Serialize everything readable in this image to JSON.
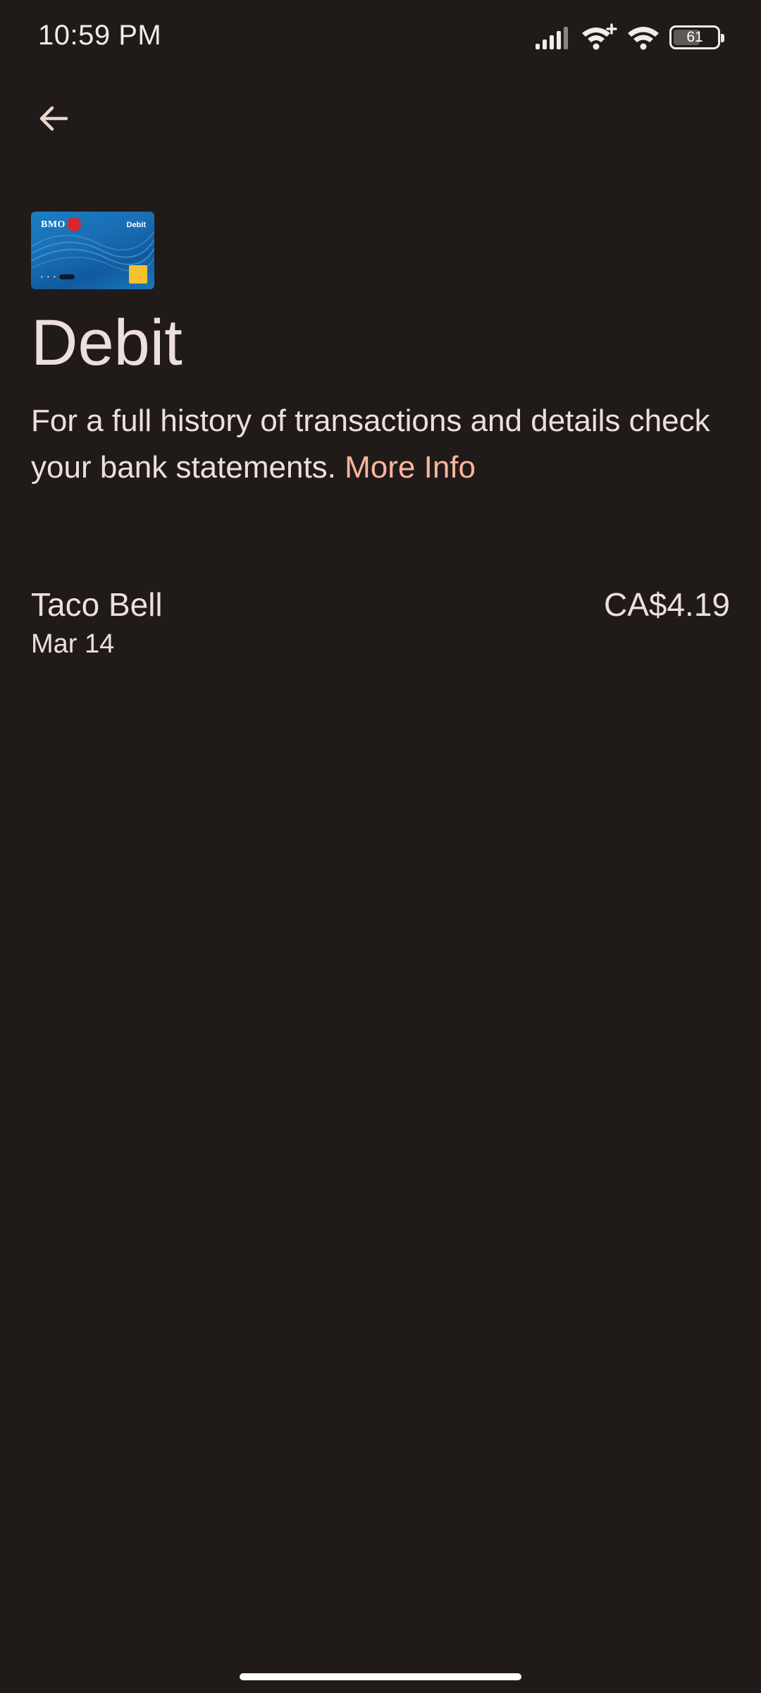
{
  "status_bar": {
    "time": "10:59 PM",
    "battery_level": "61",
    "battery_fraction": 0.61,
    "icons": [
      "signal-icon",
      "wifi-plus-icon",
      "wifi-icon",
      "battery-icon"
    ]
  },
  "header": {
    "back_icon": "arrow-left-icon"
  },
  "card": {
    "bank": "BMO",
    "type": "Debit",
    "dots": "• • • •"
  },
  "page": {
    "title": "Debit",
    "description": "For a full history of transactions and details check your bank statements.",
    "more_info": "More Info"
  },
  "transactions": [
    {
      "merchant": "Taco Bell",
      "date": "Mar 14",
      "amount": "CA$4.19"
    }
  ],
  "colors": {
    "background": "#201b19",
    "text": "#ede0dc",
    "accent": "#ffb59d"
  }
}
